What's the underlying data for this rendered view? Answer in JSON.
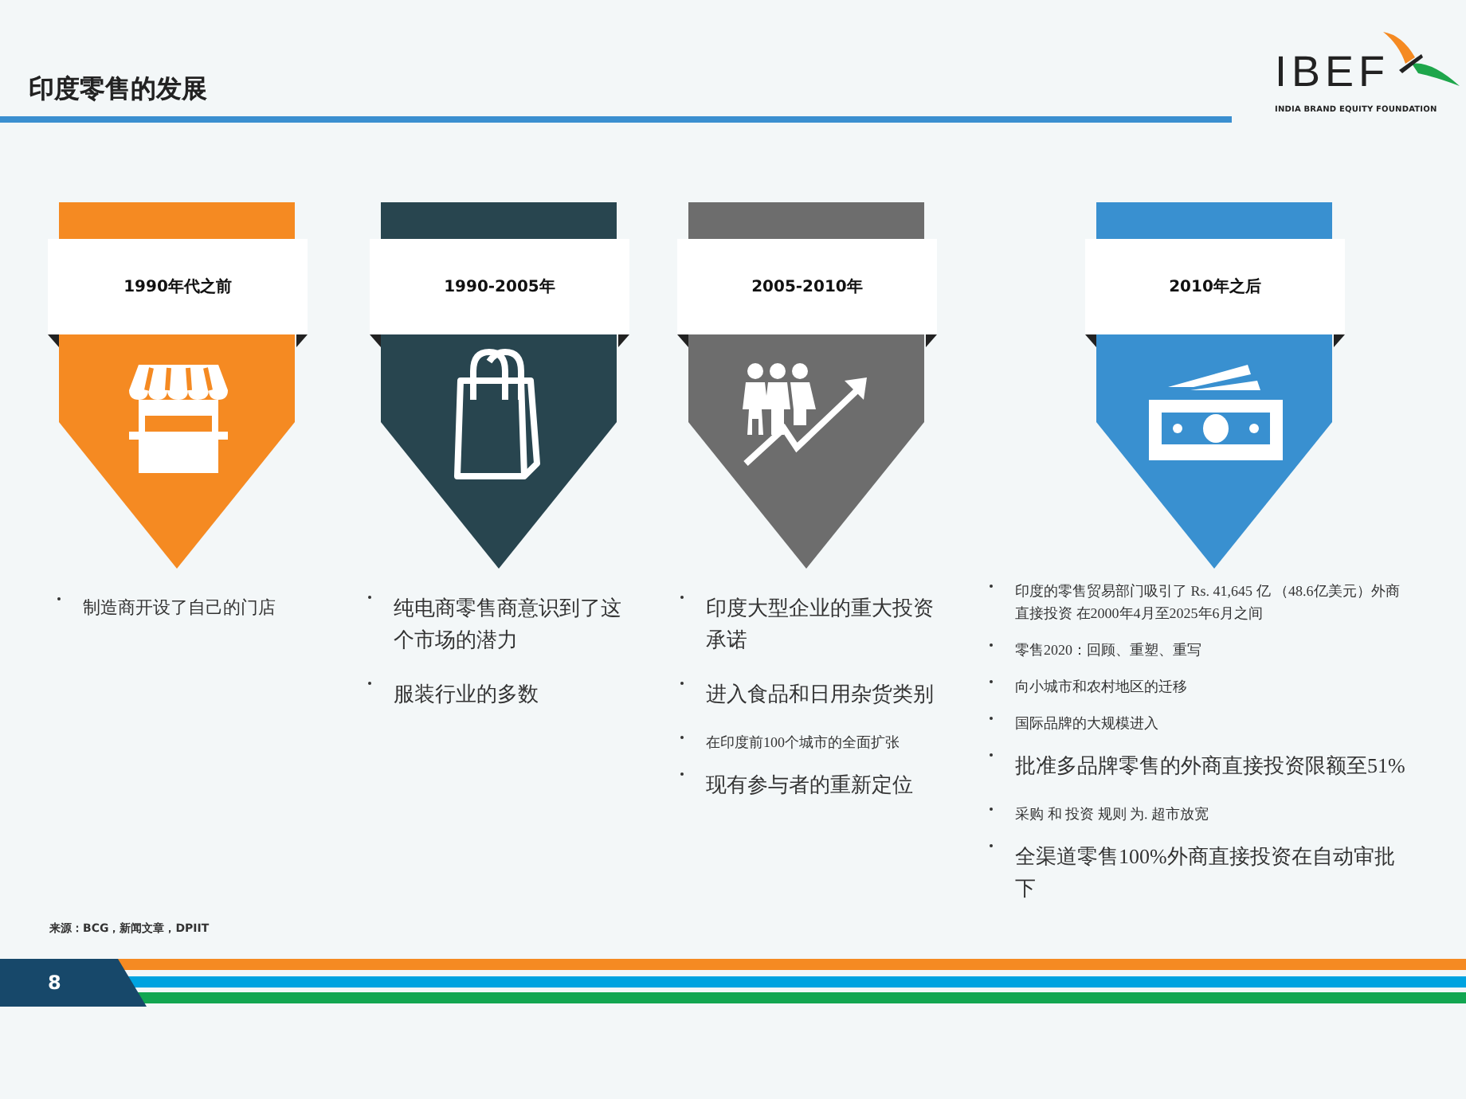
{
  "header": {
    "title": "印度零售的发展",
    "logo": {
      "name": "IBEF",
      "tagline": "INDIA BRAND EQUITY FOUNDATION"
    }
  },
  "columns": [
    {
      "period": "1990年代之前",
      "color": "#f58a22",
      "bullets": [
        {
          "kind": "medium",
          "text": "制造商开设了自己的门店"
        }
      ]
    },
    {
      "period": "1990-2005年",
      "color": "#28454f",
      "bullets": [
        {
          "kind": "large",
          "text": "纯电商零售商意识到了这个市场的潜力"
        },
        {
          "kind": "large",
          "text": "服装行业的多数"
        }
      ]
    },
    {
      "period": "2005-2010年",
      "color": "#6d6d6d",
      "bullets": [
        {
          "kind": "large",
          "text": "印度大型企业的重大投资承诺"
        },
        {
          "kind": "large",
          "text": "进入食品和日用杂货类别"
        },
        {
          "kind": "small",
          "text": "在印度前100个城市的全面扩张"
        },
        {
          "kind": "large",
          "text": "现有参与者的重新定位"
        }
      ]
    },
    {
      "period": "2010年之后",
      "color": "#3990d0",
      "bullets": [
        {
          "kind": "small",
          "text": "印度的零售贸易部门吸引了 Rs. 41,645 亿 （48.6亿美元）外商直接投资 在2000年4月至2025年6月之间"
        },
        {
          "kind": "small",
          "text": "零售2020：回顾、重塑、重写"
        },
        {
          "kind": "small",
          "text": "向小城市和农村地区的迁移"
        },
        {
          "kind": "small",
          "text": "国际品牌的大规模进入"
        },
        {
          "kind": "large",
          "text": "批准多品牌零售的外商直接投资限额至51%"
        },
        {
          "kind": "small",
          "text": "采购 和 投资 规则 为. 超市放宽"
        },
        {
          "kind": "large",
          "text": "全渠道零售100%外商直接投资在自动审批下"
        }
      ]
    }
  ],
  "footer": {
    "source": "来源：BCG，新闻文章，DPIIT",
    "page": "8"
  }
}
